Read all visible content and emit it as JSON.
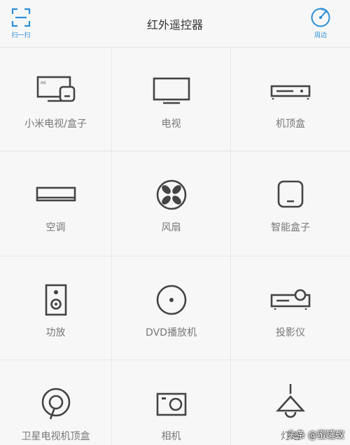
{
  "header": {
    "title": "红外遥控器",
    "scan_label": "扫一扫",
    "nearby_label": "周边"
  },
  "colors": {
    "accent": "#2a8fd6",
    "icon": "#444444",
    "label": "#777777"
  },
  "devices": [
    {
      "label": "小米电视/盒子",
      "icon": "mi-tv-box-icon"
    },
    {
      "label": "电视",
      "icon": "tv-icon"
    },
    {
      "label": "机顶盒",
      "icon": "set-top-box-icon"
    },
    {
      "label": "空调",
      "icon": "air-conditioner-icon"
    },
    {
      "label": "风扇",
      "icon": "fan-icon"
    },
    {
      "label": "智能盒子",
      "icon": "smart-box-icon"
    },
    {
      "label": "功放",
      "icon": "amplifier-icon"
    },
    {
      "label": "DVD播放机",
      "icon": "dvd-icon"
    },
    {
      "label": "投影仪",
      "icon": "projector-icon"
    },
    {
      "label": "卫星电视机顶盒",
      "icon": "satellite-icon"
    },
    {
      "label": "相机",
      "icon": "camera-icon"
    },
    {
      "label": "灯泡",
      "icon": "lamp-icon"
    }
  ],
  "watermark": "头条 @蜜罐蚁"
}
